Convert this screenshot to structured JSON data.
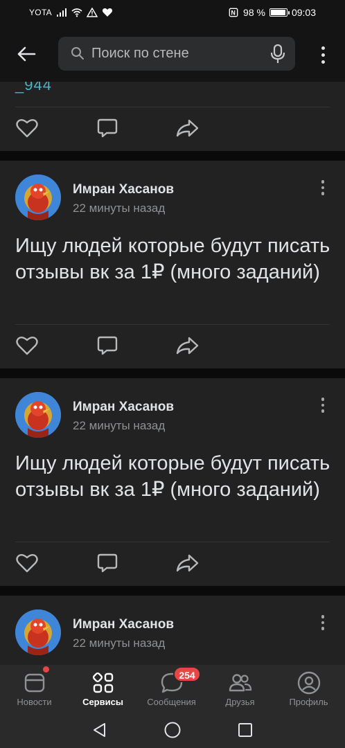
{
  "status_bar": {
    "carrier": "YOTA",
    "battery_text": "98 %",
    "battery_level": 0.98,
    "time": "09:03",
    "icons": [
      "signal-icon",
      "wifi-icon",
      "warning-icon",
      "heart-icon",
      "nfc-icon",
      "battery-icon"
    ]
  },
  "header": {
    "search_placeholder": "Поиск по стене",
    "icons": [
      "back-arrow-icon",
      "search-icon",
      "microphone-icon",
      "more-vertical-icon"
    ]
  },
  "feed": {
    "partial_post_tail": "_944",
    "posts": [
      {
        "author": "Имран Хасанов",
        "time": "22 минуты назад",
        "text": "Ищу людей которые будут писать отзывы вк за 1₽ (много заданий)"
      },
      {
        "author": "Имран Хасанов",
        "time": "22 минуты назад",
        "text": "Ищу людей которые будут писать отзывы вк за 1₽ (много заданий)"
      },
      {
        "author": "Имран Хасанов",
        "time": "22 минуты назад",
        "text": ""
      }
    ],
    "action_icons": [
      "like-icon",
      "comment-icon",
      "share-icon"
    ]
  },
  "tabbar": {
    "tabs": [
      {
        "label": "Новости",
        "icon": "news-icon",
        "active": false
      },
      {
        "label": "Сервисы",
        "icon": "services-icon",
        "active": true
      },
      {
        "label": "Сообщения",
        "icon": "messages-icon",
        "active": false,
        "badge": "254"
      },
      {
        "label": "Друзья",
        "icon": "friends-icon",
        "active": false
      },
      {
        "label": "Профиль",
        "icon": "profile-icon",
        "active": false
      }
    ]
  },
  "system_nav": {
    "icons": [
      "back-triangle-icon",
      "home-circle-icon",
      "recents-square-icon"
    ]
  },
  "colors": {
    "background": "#0a0a0a",
    "card": "#222222",
    "tabbar": "#2a2a2b",
    "accent_red": "#e64646",
    "link_teal": "#4bb3c4"
  }
}
